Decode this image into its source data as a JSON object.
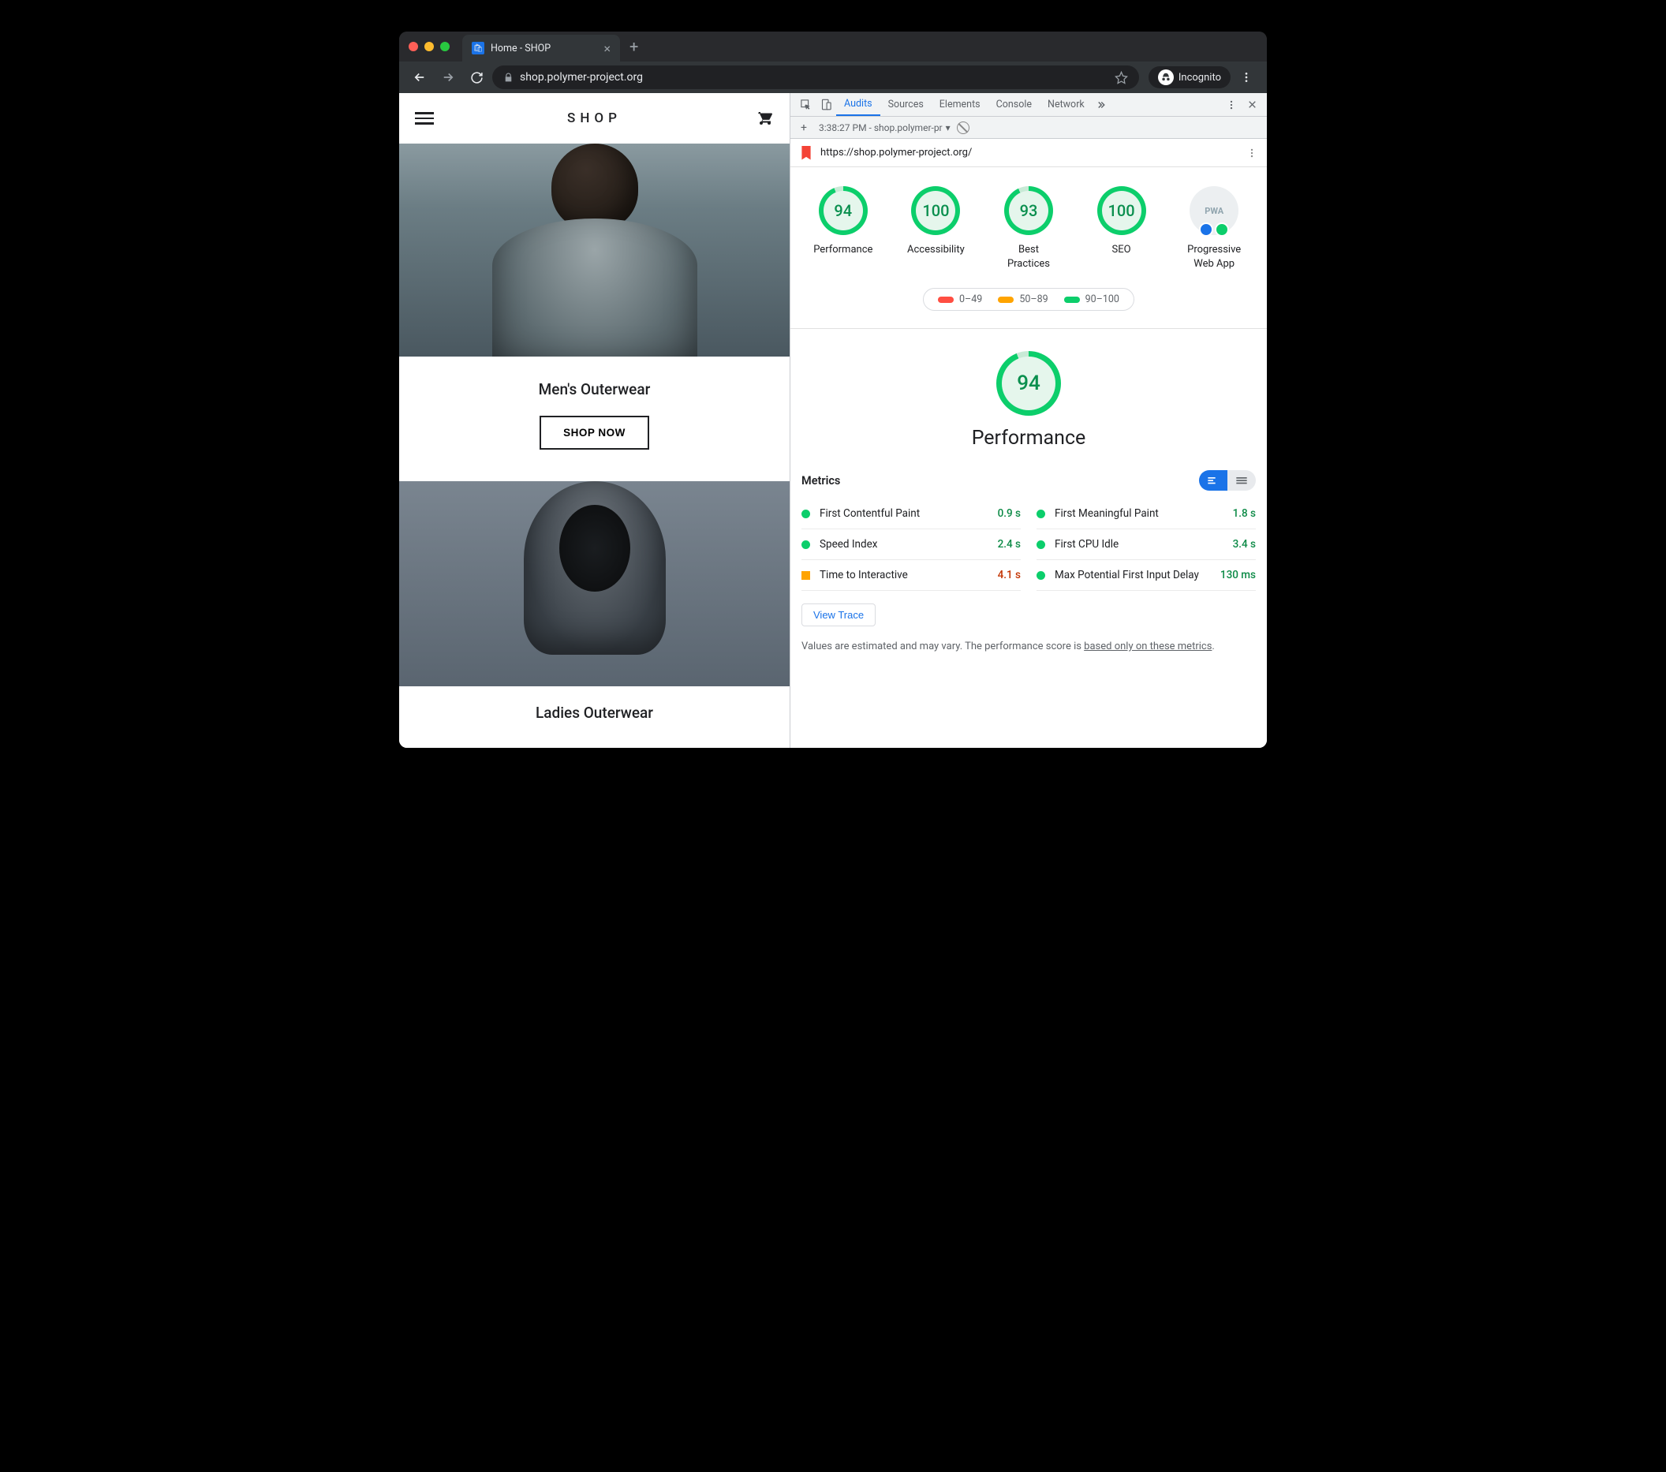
{
  "browser": {
    "tab_title": "Home - SHOP",
    "url_display": "shop.polymer-project.org",
    "incognito_label": "Incognito"
  },
  "page": {
    "logo": "SHOP",
    "category1_title": "Men's Outerwear",
    "shop_now_label": "SHOP NOW",
    "category2_title": "Ladies Outerwear"
  },
  "devtools": {
    "tabs": {
      "audits": "Audits",
      "sources": "Sources",
      "elements": "Elements",
      "console": "Console",
      "network": "Network"
    },
    "audit_time_label": "3:38:27 PM - shop.polymer-pr",
    "audit_url": "https://shop.polymer-project.org/",
    "gauges": {
      "performance": {
        "score": "94",
        "label": "Performance"
      },
      "accessibility": {
        "score": "100",
        "label": "Accessibility"
      },
      "best_practices": {
        "score": "93",
        "label": "Best\nPractices"
      },
      "seo": {
        "score": "100",
        "label": "SEO"
      },
      "pwa": {
        "label": "Progressive\nWeb App",
        "badge_text": "PWA"
      }
    },
    "legend": {
      "bad": "0–49",
      "avg": "50–89",
      "good": "90–100"
    },
    "big_score": "94",
    "big_title": "Performance",
    "metrics_header": "Metrics",
    "metrics": {
      "fcp": {
        "name": "First Contentful Paint",
        "value": "0.9 s",
        "status": "green"
      },
      "si": {
        "name": "Speed Index",
        "value": "2.4 s",
        "status": "green"
      },
      "tti": {
        "name": "Time to Interactive",
        "value": "4.1 s",
        "status": "orange"
      },
      "fmp": {
        "name": "First Meaningful Paint",
        "value": "1.8 s",
        "status": "green"
      },
      "fci": {
        "name": "First CPU Idle",
        "value": "3.4 s",
        "status": "green"
      },
      "fid": {
        "name": "Max Potential First Input Delay",
        "value": "130 ms",
        "status": "green"
      }
    },
    "view_trace_label": "View Trace",
    "note_prefix": "Values are estimated and may vary. The performance score is ",
    "note_link": "based only on these metrics",
    "note_suffix": "."
  }
}
